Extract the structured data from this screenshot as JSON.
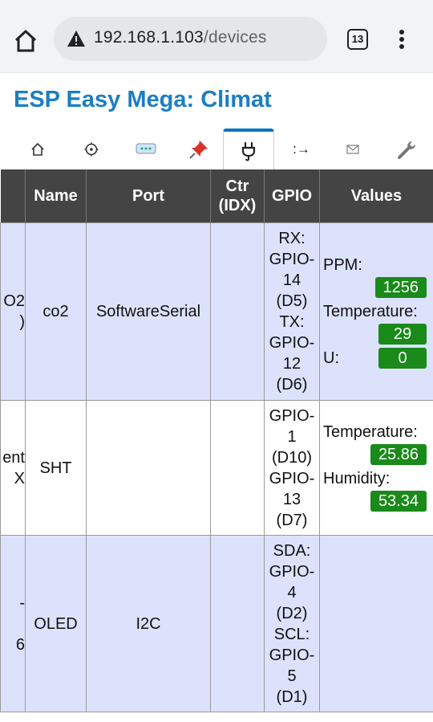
{
  "browser": {
    "url_host": "192.168.1.103",
    "url_path": "/devices",
    "tab_count": "13"
  },
  "page": {
    "title": "ESP Easy Mega: Climat"
  },
  "nav": {
    "tabs": [
      {
        "icon": "home-icon",
        "glyph": "⌂"
      },
      {
        "icon": "settings-icon",
        "glyph": "⚙"
      },
      {
        "icon": "controllers-icon",
        "glyph": "💬"
      },
      {
        "icon": "hardware-icon",
        "glyph": "📌"
      },
      {
        "icon": "devices-plug-icon",
        "glyph": "🔌"
      },
      {
        "icon": "rules-icon",
        "glyph": ":→"
      },
      {
        "icon": "notifications-icon",
        "glyph": "✉"
      },
      {
        "icon": "tools-wrench-icon",
        "glyph": "🔧"
      }
    ],
    "active_index": 4
  },
  "table": {
    "headers": {
      "name": "Name",
      "port": "Port",
      "ctr_line1": "Ctr",
      "ctr_line2": "(IDX)",
      "gpio": "GPIO",
      "values": "Values"
    },
    "rows": [
      {
        "device_clip_1": "O2",
        "device_clip_2": ")",
        "name": "co2",
        "port": "SoftwareSerial",
        "ctr": "",
        "gpio": [
          "RX:",
          "GPIO-",
          "14",
          "(D5)",
          "TX:",
          "GPIO-",
          "12",
          "(D6)"
        ],
        "values": [
          {
            "label": "PPM:",
            "value": "1256"
          },
          {
            "label": "Temperature:",
            "value": "29"
          },
          {
            "label": "U:",
            "value": "0"
          }
        ]
      },
      {
        "device_clip_1": "ent",
        "device_clip_2": "X",
        "name": "SHT",
        "port": "",
        "ctr": "",
        "gpio": [
          "GPIO-",
          "1",
          "(D10)",
          "GPIO-",
          "13",
          "(D7)"
        ],
        "values": [
          {
            "label": "Temperature:",
            "value": "25.86"
          },
          {
            "label": "Humidity:",
            "value": "53.34"
          }
        ]
      },
      {
        "device_clip_1": "-",
        "device_clip_2": "6",
        "name": "OLED",
        "port": "I2C",
        "ctr": "",
        "gpio": [
          "SDA:",
          "GPIO-",
          "4",
          "(D2)",
          "SCL:",
          "GPIO-",
          "5",
          "(D1)"
        ],
        "values": []
      }
    ]
  },
  "colors": {
    "accent": "#1c7ec4",
    "header_bg": "#444444",
    "row_odd": "#dce2fb",
    "badge": "#1a8a1a"
  }
}
